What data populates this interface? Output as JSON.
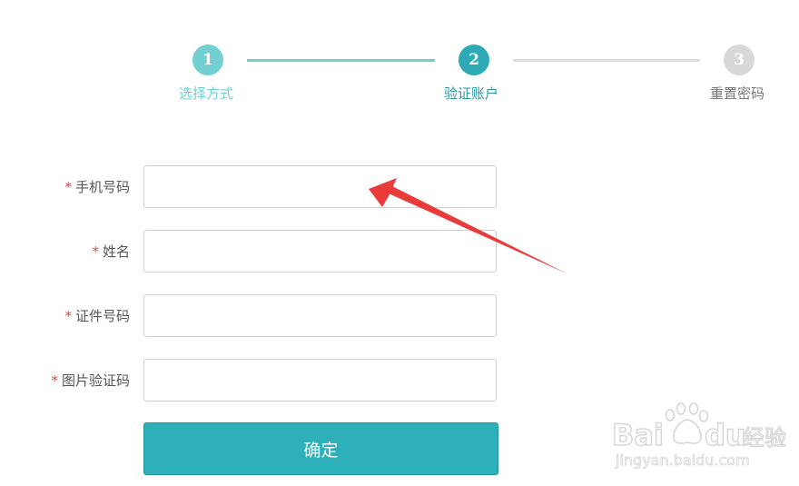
{
  "steps": [
    {
      "number": "1",
      "label": "选择方式",
      "state": "done"
    },
    {
      "number": "2",
      "label": "验证账户",
      "state": "active"
    },
    {
      "number": "3",
      "label": "重置密码",
      "state": "pending"
    }
  ],
  "colors": {
    "done": "#72d0d3",
    "active": "#2eaab6",
    "pending": "#d8d8d8",
    "required": "#e0463e",
    "button": "#2eb0ba",
    "arrow": "#ea3b3b"
  },
  "form": {
    "required_mark": "*",
    "fields": [
      {
        "label": "手机号码",
        "value": "",
        "placeholder": ""
      },
      {
        "label": "姓名",
        "value": "",
        "placeholder": ""
      },
      {
        "label": "证件号码",
        "value": "",
        "placeholder": ""
      },
      {
        "label": "图片验证码",
        "value": "",
        "placeholder": ""
      }
    ],
    "submit_label": "确定"
  },
  "watermark": {
    "brand": "Bai du 经验",
    "url": "jingyan.baidu.com"
  }
}
